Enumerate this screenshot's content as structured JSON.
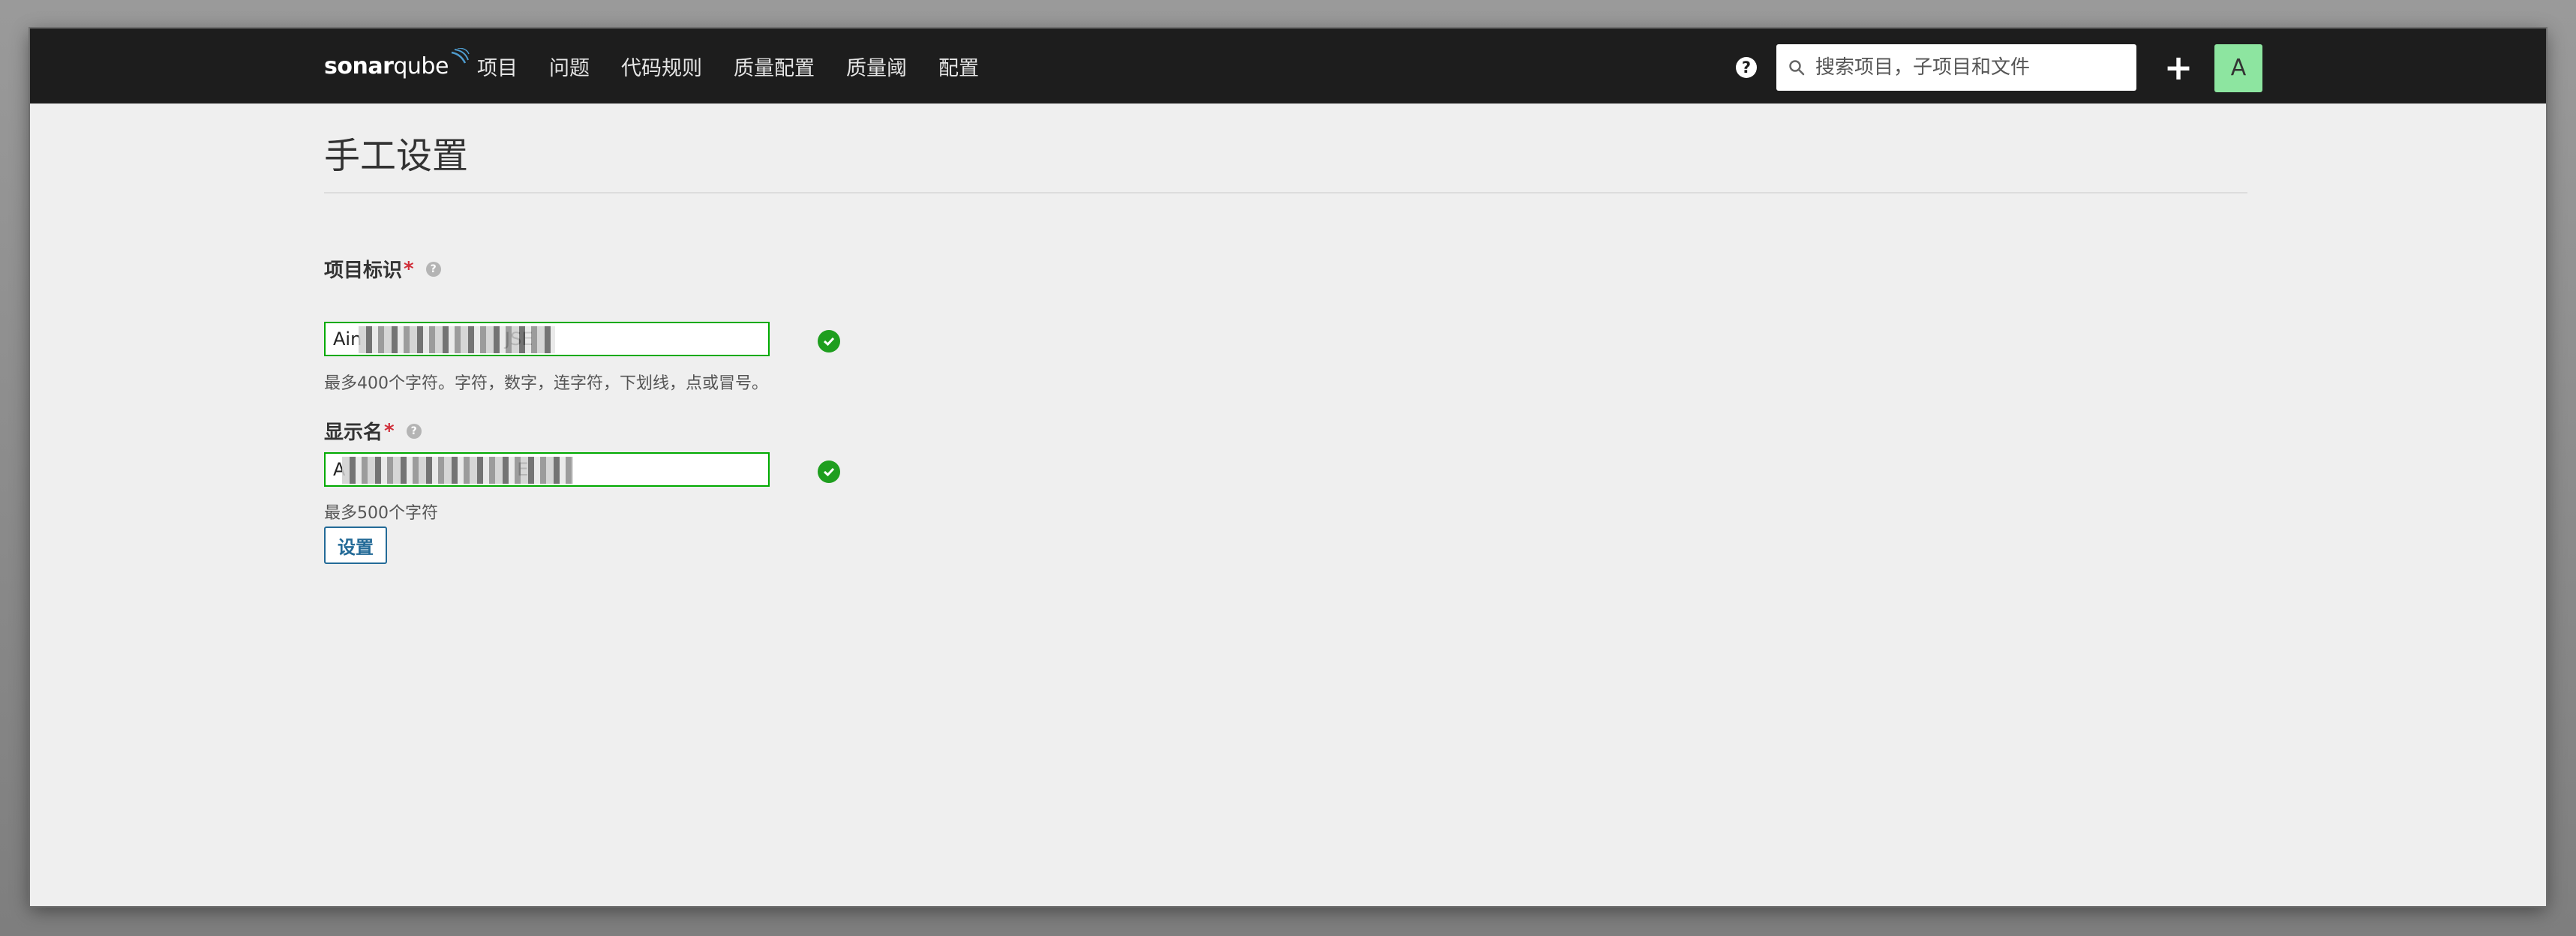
{
  "header": {
    "logo_text_1": "sonar",
    "logo_text_2": "qube",
    "nav": [
      "项目",
      "问题",
      "代码规则",
      "质量配置",
      "质量阈",
      "配置"
    ],
    "help_icon": "?",
    "search_placeholder": "搜索项目，子项目和文件",
    "add_icon": "+",
    "avatar_letter": "A"
  },
  "page": {
    "title": "手工设置",
    "project_key": {
      "label": "项目标识",
      "required_mark": "*",
      "help_icon": "?",
      "value": "Ain                         JSE",
      "hint": "最多400个字符。字符，数字，连字符，下划线，点或冒号。"
    },
    "display_name": {
      "label": "显示名",
      "required_mark": "*",
      "help_icon": "?",
      "value": "A                              E",
      "hint": "最多500个字符"
    },
    "submit_label": "设置"
  },
  "colors": {
    "topbar": "#1d1d1d",
    "valid_border": "#00aa00",
    "check_icon": "#1e9e1e",
    "button_border": "#236a97",
    "avatar_bg": "#8de5a0",
    "required": "#d02f3a"
  }
}
